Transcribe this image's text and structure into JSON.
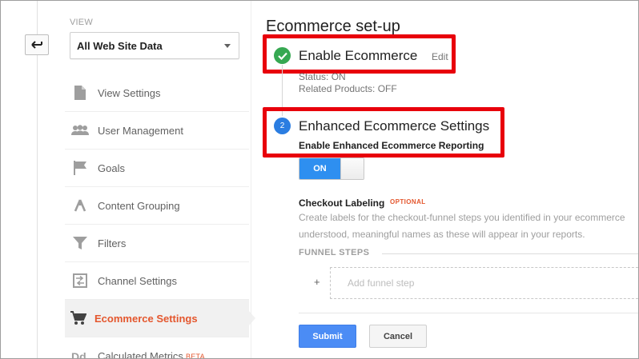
{
  "sidebar": {
    "view_label": "VIEW",
    "view_select": "All Web Site Data",
    "items": [
      {
        "label": "View Settings",
        "icon": "document-icon"
      },
      {
        "label": "User Management",
        "icon": "users-icon"
      },
      {
        "label": "Goals",
        "icon": "flag-icon"
      },
      {
        "label": "Content Grouping",
        "icon": "content-grouping-icon"
      },
      {
        "label": "Filters",
        "icon": "filter-icon"
      },
      {
        "label": "Channel Settings",
        "icon": "channel-icon"
      },
      {
        "label": "Ecommerce Settings",
        "icon": "cart-icon",
        "active": true
      },
      {
        "label": "Calculated Metrics",
        "icon": "dd-icon",
        "badge": "BETA"
      }
    ]
  },
  "main": {
    "title": "Ecommerce set-up",
    "step1": {
      "title": "Enable Ecommerce",
      "edit": "Edit",
      "status": "Status: ON",
      "related": "Related Products: OFF"
    },
    "step2": {
      "number": "2",
      "title": "Enhanced Ecommerce Settings",
      "subtitle": "Enable Enhanced Ecommerce Reporting",
      "toggle": "ON"
    },
    "checkout": {
      "title": "Checkout Labeling",
      "optional": "OPTIONAL",
      "desc_line1": "Create labels for the checkout-funnel steps you identified in your ecommerce",
      "desc_line2": "understood, meaningful names as these will appear in your reports.",
      "funnel_label": "FUNNEL STEPS",
      "plus": "+",
      "add_step": "Add funnel step"
    },
    "buttons": {
      "submit": "Submit",
      "cancel": "Cancel"
    }
  },
  "colors": {
    "highlight": "#e8000b",
    "active_text": "#e4572e",
    "success": "#36a852",
    "primary": "#2e8ff0"
  }
}
